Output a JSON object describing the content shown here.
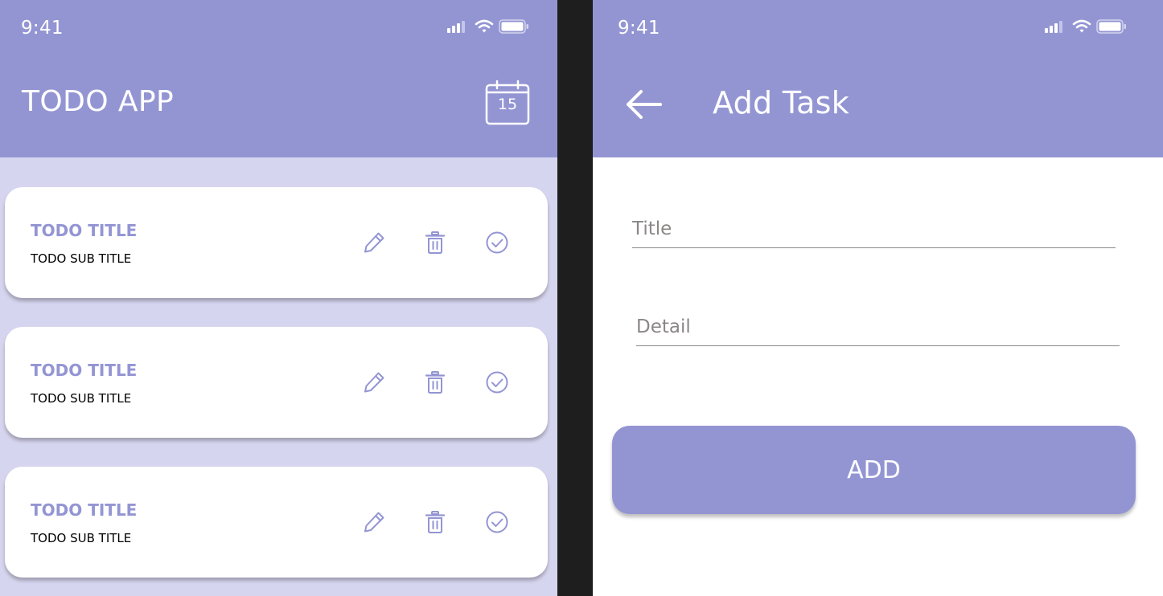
{
  "status_bar": {
    "time": "9:41"
  },
  "list_screen": {
    "title": "TODO APP",
    "calendar_day": "15",
    "todos": [
      {
        "title": "TODO TITLE",
        "subtitle": "TODO SUB TITLE"
      },
      {
        "title": "TODO TITLE",
        "subtitle": "TODO SUB TITLE"
      },
      {
        "title": "TODO TITLE",
        "subtitle": "TODO SUB TITLE"
      }
    ],
    "icons": {
      "calendar": "calendar-icon",
      "edit": "pencil-icon",
      "delete": "trash-icon",
      "complete": "check-circle-icon"
    }
  },
  "add_screen": {
    "title": "Add Task",
    "back_icon": "arrow-left-icon",
    "title_field": {
      "placeholder": "Title",
      "value": ""
    },
    "detail_field": {
      "placeholder": "Detail",
      "value": ""
    },
    "add_button": "ADD"
  },
  "colors": {
    "primary": "#9395D3",
    "list_background": "#D6D5EF",
    "card_background": "#FFFFFF",
    "divider": "#1E1E1E",
    "field_line": "#8B8787"
  }
}
